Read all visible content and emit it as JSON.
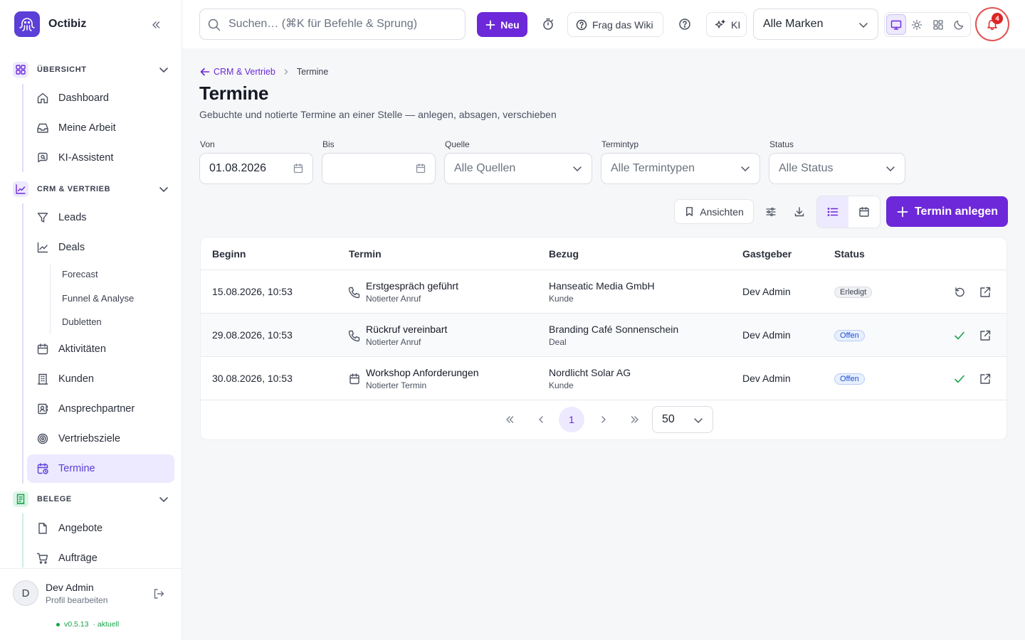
{
  "app": {
    "name": "Octibiz"
  },
  "sidebar": {
    "sections": [
      {
        "label": "ÜBERSICHT",
        "items": [
          "Dashboard",
          "Meine Arbeit",
          "KI-Assistent"
        ]
      },
      {
        "label": "CRM & VERTRIEB",
        "items": [
          "Leads",
          "Deals",
          "Aktivitäten",
          "Kunden",
          "Ansprechpartner",
          "Vertriebsziele",
          "Termine"
        ],
        "deals_sub": [
          "Forecast",
          "Funnel & Analyse",
          "Dubletten"
        ]
      },
      {
        "label": "BELEGE",
        "items": [
          "Angebote",
          "Aufträge"
        ]
      }
    ],
    "active_item": "Termine"
  },
  "user": {
    "initial": "D",
    "name": "Dev Admin",
    "sub": "Profil bearbeiten",
    "version": "v0.5.13",
    "version_status": "· aktuell"
  },
  "topbar": {
    "search_placeholder": "Suchen… (⌘K für Befehle & Sprung)",
    "new_label": "Neu",
    "wiki_label": "Frag das Wiki",
    "ki_label": "KI",
    "brand_select": "Alle Marken",
    "notification_count": "4"
  },
  "breadcrumb": {
    "parent": "CRM & Vertrieb",
    "current": "Termine"
  },
  "page": {
    "title": "Termine",
    "subtitle": "Gebuchte und notierte Termine an einer Stelle — anlegen, absagen, verschieben"
  },
  "filters": {
    "von": {
      "label": "Von",
      "value": "01.08.2026"
    },
    "bis": {
      "label": "Bis",
      "value": ""
    },
    "quelle": {
      "label": "Quelle",
      "value": "Alle Quellen"
    },
    "termintyp": {
      "label": "Termintyp",
      "value": "Alle Termintypen"
    },
    "status": {
      "label": "Status",
      "value": "Alle Status"
    }
  },
  "toolbar": {
    "ansichten_label": "Ansichten",
    "create_label": "Termin anlegen"
  },
  "table": {
    "columns": [
      "Beginn",
      "Termin",
      "Bezug",
      "Gastgeber",
      "Status"
    ],
    "rows": [
      {
        "beginn": "15.08.2026, 10:53",
        "termin": "Erstgespräch geführt",
        "termin_sub": "Notierter Anruf",
        "termin_icon": "phone-icon",
        "bezug": "Hanseatic Media GmbH",
        "bezug_sub": "Kunde",
        "gastgeber": "Dev Admin",
        "status": "Erledigt",
        "action": "undo-icon"
      },
      {
        "beginn": "29.08.2026, 10:53",
        "termin": "Rückruf vereinbart",
        "termin_sub": "Notierter Anruf",
        "termin_icon": "phone-icon",
        "bezug": "Branding Café Sonnenschein",
        "bezug_sub": "Deal",
        "gastgeber": "Dev Admin",
        "status": "Offen",
        "action": "check-icon"
      },
      {
        "beginn": "30.08.2026, 10:53",
        "termin": "Workshop Anforderungen",
        "termin_sub": "Notierter Termin",
        "termin_icon": "calendar-icon",
        "bezug": "Nordlicht Solar AG",
        "bezug_sub": "Kunde",
        "gastgeber": "Dev Admin",
        "status": "Offen",
        "action": "check-icon"
      }
    ]
  },
  "pagination": {
    "current_page": "1",
    "page_size": "50"
  },
  "colors": {
    "accent": "#6d28d9",
    "active_bg": "#ede9fe",
    "danger": "#dc2626",
    "success": "#16a34a"
  }
}
